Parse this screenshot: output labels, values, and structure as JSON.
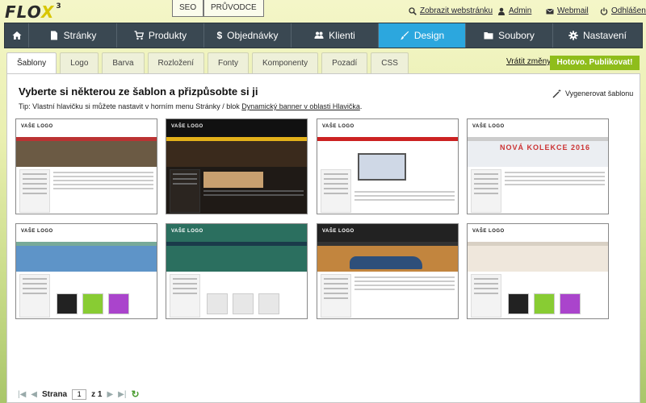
{
  "brand": {
    "name_a": "FLO",
    "name_x": "X",
    "version": "3"
  },
  "top_buttons": [
    {
      "label": "SEO"
    },
    {
      "label": "PRŮVODCE"
    }
  ],
  "top_links": [
    {
      "label": "Zobrazit webstránku",
      "icon": "search-icon"
    },
    {
      "label": "Admin",
      "icon": "user-icon"
    },
    {
      "label": "Webmail",
      "icon": "mail-icon"
    },
    {
      "label": "Odhlášení",
      "icon": "power-icon"
    }
  ],
  "nav": [
    {
      "label": "",
      "icon": "home-icon"
    },
    {
      "label": "Stránky",
      "icon": "page-icon"
    },
    {
      "label": "Produkty",
      "icon": "cart-icon"
    },
    {
      "label": "Objednávky",
      "icon": "dollar-icon"
    },
    {
      "label": "Klienti",
      "icon": "users-icon"
    },
    {
      "label": "Design",
      "icon": "brush-icon",
      "active": true
    },
    {
      "label": "Soubory",
      "icon": "folder-icon"
    },
    {
      "label": "Nastavení",
      "icon": "gear-icon"
    }
  ],
  "subtabs": [
    "Šablony",
    "Logo",
    "Barva",
    "Rozložení",
    "Fonty",
    "Komponenty",
    "Pozadí",
    "CSS"
  ],
  "active_subtab": "Šablony",
  "actions": {
    "revert": "Vrátit změny",
    "publish": "Hotovo. Publikovat!"
  },
  "content": {
    "heading": "Vyberte si některou ze šablon a přizpůsobte si ji",
    "tip_prefix": "Tip: Vlastní hlavičku si můžete nastavit v horním menu Stránky / blok ",
    "tip_link": "Dynamický banner v oblasti Hlavička",
    "tip_suffix": ".",
    "generate": "Vygenerovat šablonu"
  },
  "templates": [
    {
      "logo": "VAŠE LOGO",
      "banner": "#6b5a44",
      "banner_text": ""
    },
    {
      "logo": "VAŠE LOGO",
      "banner": "#3a2a1c",
      "banner_text": ""
    },
    {
      "logo": "VAŠE LOGO",
      "banner": "#ffffff",
      "banner_text": ""
    },
    {
      "logo": "VAŠE LOGO",
      "banner": "#ebeef2",
      "banner_text": "NOVÁ KOLEKCE 2016"
    },
    {
      "logo": "VAŠE LOGO",
      "banner": "#5e94c8",
      "banner_text": ""
    },
    {
      "logo": "VAŠE LOGO",
      "banner": "#2b6f5f",
      "banner_text": ""
    },
    {
      "logo": "VAŠE LOGO",
      "banner": "#c2853e",
      "banner_text": ""
    },
    {
      "logo": "VAŠE LOGO",
      "banner": "#efe7dc",
      "banner_text": ""
    }
  ],
  "pager": {
    "label": "Strana",
    "page": "1",
    "of_label": "z 1"
  }
}
